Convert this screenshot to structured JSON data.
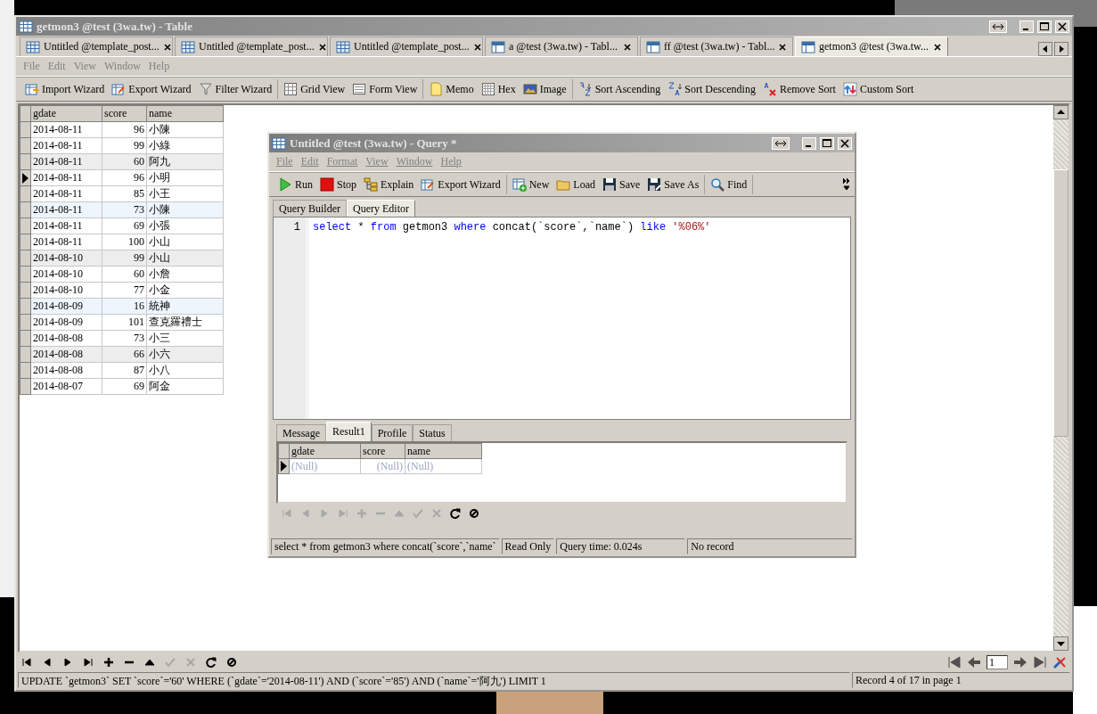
{
  "main_window": {
    "title": "getmon3 @test (3wa.tw) - Table",
    "tabs": [
      {
        "label": "Untitled @template_post...",
        "kind": "query",
        "selected": false
      },
      {
        "label": "Untitled @template_post...",
        "kind": "query",
        "selected": false
      },
      {
        "label": "Untitled @template_post...",
        "kind": "query",
        "selected": false
      },
      {
        "label": "a @test (3wa.tw) - Tabl...",
        "kind": "table",
        "selected": false
      },
      {
        "label": "ff @test (3wa.tw) - Tabl...",
        "kind": "table",
        "selected": false
      },
      {
        "label": "getmon3 @test (3wa.tw...",
        "kind": "table",
        "selected": true
      }
    ],
    "menu": [
      "File",
      "Edit",
      "View",
      "Window",
      "Help"
    ],
    "toolbar": [
      [
        {
          "label": "Import Wizard",
          "kind": "import"
        },
        {
          "label": "Export Wizard",
          "kind": "export"
        },
        {
          "label": "Filter Wizard",
          "kind": "filter"
        }
      ],
      [
        {
          "label": "Grid View",
          "kind": "grid"
        },
        {
          "label": "Form View",
          "kind": "form"
        }
      ],
      [
        {
          "label": "Memo",
          "kind": "memo"
        },
        {
          "label": "Hex",
          "kind": "hex"
        },
        {
          "label": "Image",
          "kind": "image"
        }
      ],
      [
        {
          "label": "Sort Ascending",
          "kind": "sort-asc"
        },
        {
          "label": "Sort Descending",
          "kind": "sort-desc"
        },
        {
          "label": "Remove Sort",
          "kind": "remove-sort"
        },
        {
          "label": "Custom Sort",
          "kind": "custom-sort"
        }
      ]
    ],
    "table": {
      "columns": [
        "gdate",
        "score",
        "name"
      ],
      "rows": [
        {
          "cells": [
            "2014-08-11",
            "96",
            "小陳"
          ],
          "selected": false,
          "color": "#ffffff"
        },
        {
          "cells": [
            "2014-08-11",
            "99",
            "小綠"
          ],
          "selected": false,
          "color": "#ffffff"
        },
        {
          "cells": [
            "2014-08-11",
            "60",
            "阿九"
          ],
          "selected": false,
          "color": "#ededed"
        },
        {
          "cells": [
            "2014-08-11",
            "96",
            "小明"
          ],
          "selected": true,
          "color": "#ffffff"
        },
        {
          "cells": [
            "2014-08-11",
            "85",
            "小王"
          ],
          "selected": false,
          "color": "#ffffff"
        },
        {
          "cells": [
            "2014-08-11",
            "73",
            "小陳"
          ],
          "selected": false,
          "color": "#eef5fd"
        },
        {
          "cells": [
            "2014-08-11",
            "69",
            "小張"
          ],
          "selected": false,
          "color": "#ffffff"
        },
        {
          "cells": [
            "2014-08-11",
            "100",
            "小山"
          ],
          "selected": false,
          "color": "#ffffff"
        },
        {
          "cells": [
            "2014-08-10",
            "99",
            "小山"
          ],
          "selected": false,
          "color": "#ededed"
        },
        {
          "cells": [
            "2014-08-10",
            "60",
            "小詹"
          ],
          "selected": false,
          "color": "#ffffff"
        },
        {
          "cells": [
            "2014-08-10",
            "77",
            "小金"
          ],
          "selected": false,
          "color": "#ffffff"
        },
        {
          "cells": [
            "2014-08-09",
            "16",
            "統神"
          ],
          "selected": false,
          "color": "#eef5fd"
        },
        {
          "cells": [
            "2014-08-09",
            "101",
            "查克羅禮士"
          ],
          "selected": false,
          "color": "#ffffff"
        },
        {
          "cells": [
            "2014-08-08",
            "73",
            "小三"
          ],
          "selected": false,
          "color": "#ffffff"
        },
        {
          "cells": [
            "2014-08-08",
            "66",
            "小六"
          ],
          "selected": false,
          "color": "#ededed"
        },
        {
          "cells": [
            "2014-08-08",
            "87",
            "小八"
          ],
          "selected": false,
          "color": "#ffffff"
        },
        {
          "cells": [
            "2014-08-07",
            "69",
            "阿金"
          ],
          "selected": false,
          "color": "#ffffff"
        }
      ]
    },
    "nav": [
      {
        "kind": "first",
        "disabled": false
      },
      {
        "kind": "prev",
        "disabled": false
      },
      {
        "kind": "next",
        "disabled": false
      },
      {
        "kind": "last",
        "disabled": false
      },
      {
        "kind": "add",
        "disabled": false
      },
      {
        "kind": "delete",
        "disabled": false
      },
      {
        "kind": "up",
        "disabled": false
      },
      {
        "kind": "apply",
        "disabled": true
      },
      {
        "kind": "cancel",
        "disabled": true
      },
      {
        "kind": "refresh",
        "disabled": false
      },
      {
        "kind": "stop",
        "disabled": false
      }
    ],
    "page": "1",
    "status_bar": {
      "sql": "UPDATE `getmon3` SET `score`='60' WHERE (`gdate`='2014-08-11') AND (`score`='85') AND (`name`='阿九') LIMIT 1",
      "record": "Record 4 of 17 in page 1"
    }
  },
  "query_window": {
    "title": "Untitled @test (3wa.tw) - Query *",
    "menu": [
      "File",
      "Edit",
      "Format",
      "View",
      "Window",
      "Help"
    ],
    "toolbar": [
      [
        {
          "label": "Run",
          "kind": "run"
        },
        {
          "label": "Stop",
          "kind": "stop"
        },
        {
          "label": "Explain",
          "kind": "explain"
        },
        {
          "label": "Export Wizard",
          "kind": "export"
        }
      ],
      [
        {
          "label": "New",
          "kind": "new"
        },
        {
          "label": "Load",
          "kind": "load"
        },
        {
          "label": "Save",
          "kind": "save"
        },
        {
          "label": "Save As",
          "kind": "save-as"
        }
      ],
      [
        {
          "label": "Find",
          "kind": "find"
        }
      ]
    ],
    "editor_tabs": [
      {
        "label": "Query Builder",
        "selected": false
      },
      {
        "label": "Query Editor",
        "selected": true
      }
    ],
    "line_number": "1",
    "sql": [
      {
        "text": "select",
        "kind": "keyword"
      },
      {
        "text": " * ",
        "kind": "plain"
      },
      {
        "text": "from",
        "kind": "keyword"
      },
      {
        "text": " getmon3 ",
        "kind": "plain"
      },
      {
        "text": "where",
        "kind": "keyword"
      },
      {
        "text": " concat(`score`,`name`) ",
        "kind": "plain"
      },
      {
        "text": "like",
        "kind": "keyword"
      },
      {
        "text": " '%06%'",
        "kind": "string"
      }
    ],
    "result_tabs": [
      {
        "label": "Message",
        "selected": false
      },
      {
        "label": "Result1",
        "selected": true
      },
      {
        "label": "Profile",
        "selected": false
      },
      {
        "label": "Status",
        "selected": false
      }
    ],
    "result": {
      "columns": [
        "gdate",
        "score",
        "name"
      ],
      "rows": [
        {
          "cells": [
            "(Null)",
            "(Null)",
            "(Null)"
          ],
          "selected": true
        }
      ]
    },
    "nav": [
      {
        "kind": "first",
        "disabled": true
      },
      {
        "kind": "prev",
        "disabled": true
      },
      {
        "kind": "next",
        "disabled": true
      },
      {
        "kind": "last",
        "disabled": true
      },
      {
        "kind": "add",
        "disabled": true
      },
      {
        "kind": "delete",
        "disabled": true
      },
      {
        "kind": "up",
        "disabled": true
      },
      {
        "kind": "apply",
        "disabled": true
      },
      {
        "kind": "cancel",
        "disabled": true
      },
      {
        "kind": "refresh",
        "disabled": false
      },
      {
        "kind": "stop",
        "disabled": false
      }
    ],
    "status_bar": [
      "select * from getmon3 where concat(`score`,`name`",
      "Read Only",
      "Query time: 0.024s",
      "No record"
    ]
  }
}
